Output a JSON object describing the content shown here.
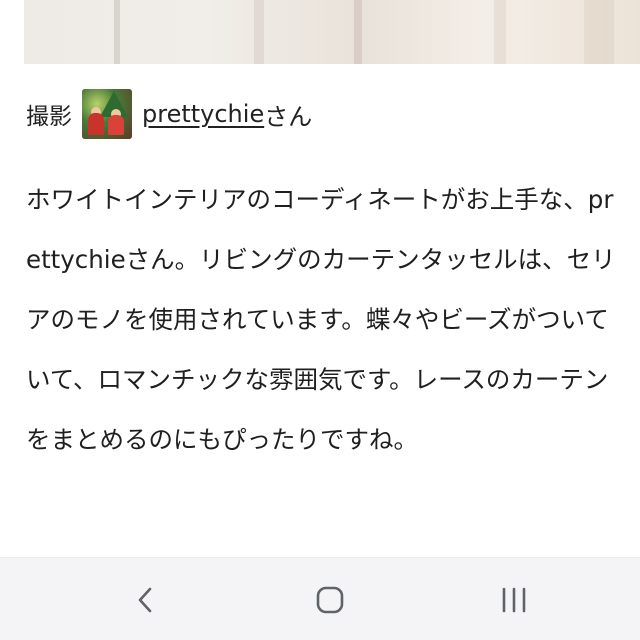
{
  "credit": {
    "label": "撮影",
    "username": "prettychie",
    "suffix": "さん"
  },
  "article": {
    "text": "ホワイトインテリアのコーディネートがお上手な、prettychieさん。リビングのカーテンタッセルは、セリアのモノを使用されています。蝶々やビーズがついていて、ロマンチックな雰囲気です。レースのカーテンをまとめるのにもぴったりですね。"
  },
  "navbar": {
    "icons": [
      "back-icon",
      "home-icon",
      "recent-apps-icon"
    ],
    "icon_color": "#5f6368",
    "background": "#f4f4f6"
  }
}
